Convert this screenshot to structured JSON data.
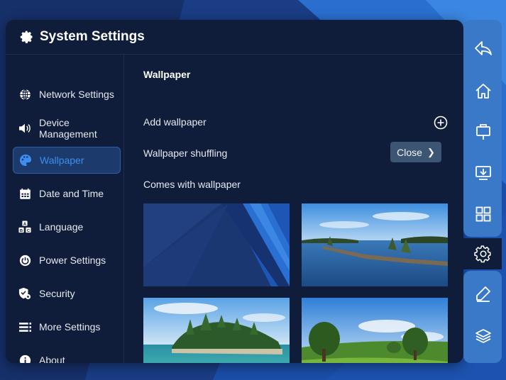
{
  "window": {
    "title": "System Settings",
    "icon": "gear-icon"
  },
  "sidebar": {
    "items": [
      {
        "label": "Network Settings",
        "icon": "globe-icon",
        "active": false
      },
      {
        "label": "Device Management",
        "icon": "speaker-icon",
        "active": false
      },
      {
        "label": "Wallpaper",
        "icon": "palette-icon",
        "active": true
      },
      {
        "label": "Date and Time",
        "icon": "calendar-icon",
        "active": false
      },
      {
        "label": "Language",
        "icon": "language-icon",
        "active": false
      },
      {
        "label": "Power Settings",
        "icon": "power-icon",
        "active": false
      },
      {
        "label": "Security",
        "icon": "shield-icon",
        "active": false
      },
      {
        "label": "More Settings",
        "icon": "list-icon",
        "active": false
      },
      {
        "label": "About",
        "icon": "info-icon",
        "active": false
      }
    ]
  },
  "content": {
    "section_title": "Wallpaper",
    "add_label": "Add wallpaper",
    "shuffle_label": "Wallpaper shuffling",
    "shuffle_value": "Close",
    "builtin_label": "Comes with wallpaper",
    "wallpapers": [
      {
        "name": "blue-geometric"
      },
      {
        "name": "lake-shoreline"
      },
      {
        "name": "forested-island-sea"
      },
      {
        "name": "green-meadow-trees"
      }
    ]
  },
  "dock": {
    "icons": [
      "back-icon",
      "home-icon",
      "whiteboard-icon",
      "screen-share-icon",
      "apps-grid-icon",
      "settings-gear-icon",
      "pen-icon",
      "layers-icon"
    ]
  },
  "colors": {
    "panel": "#0f1c3a",
    "accent": "#3d8df0",
    "dock": "#3a78c8",
    "active_bg": "#1c3a6b"
  }
}
